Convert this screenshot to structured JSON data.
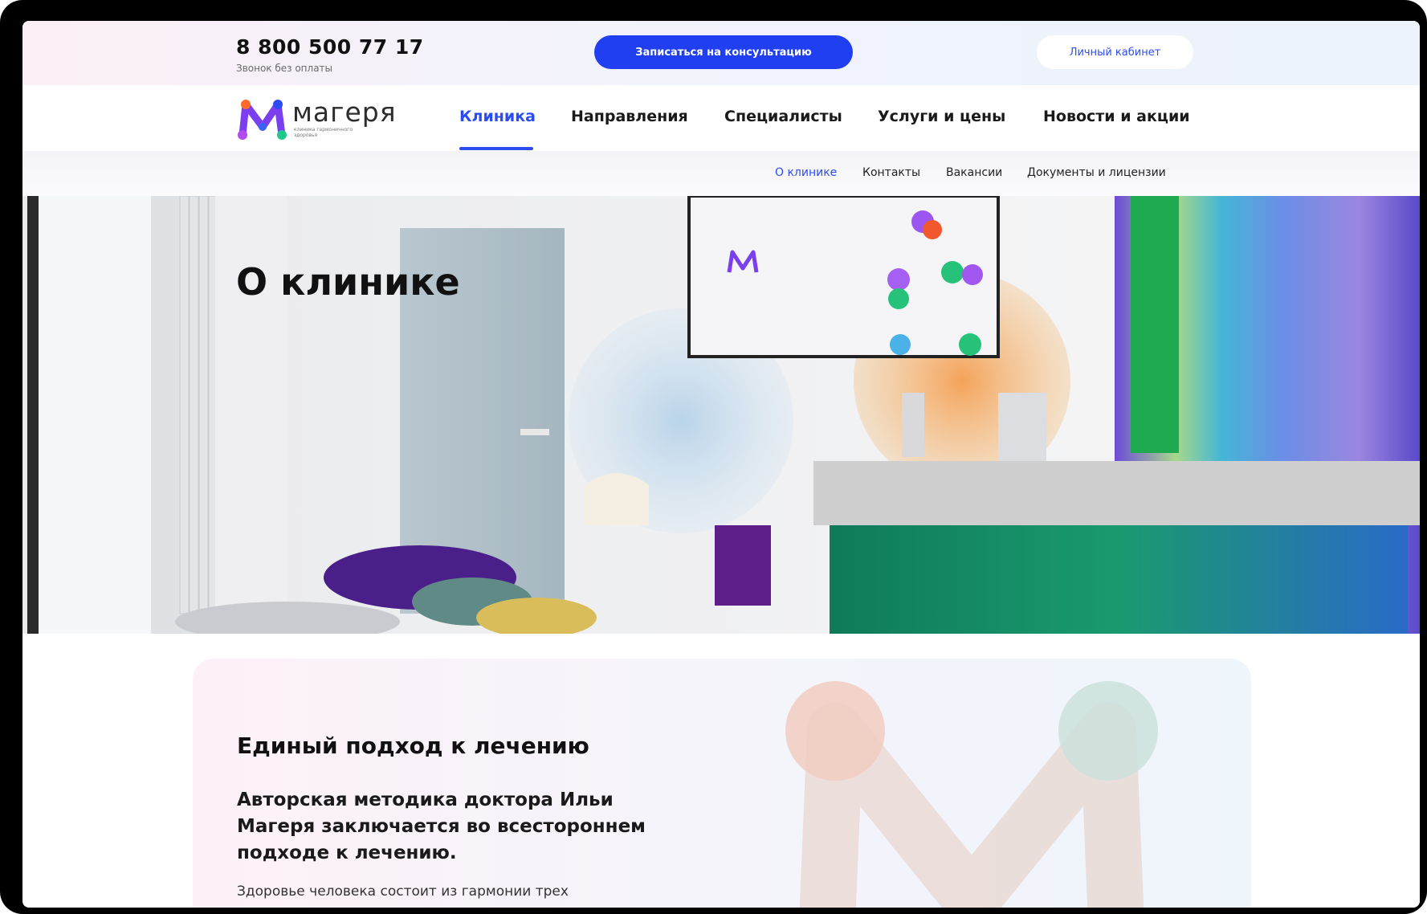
{
  "topbar": {
    "phone": "8 800 500 77 17",
    "phone_caption": "Звонок без оплаты",
    "cta_label": "Записаться на консультацию",
    "cabinet_label": "Личный кабинет"
  },
  "brand": {
    "name": "магеря",
    "tagline": "клиника гармоничного здоровья"
  },
  "nav": {
    "items": [
      {
        "label": "Клиника"
      },
      {
        "label": "Направления"
      },
      {
        "label": "Специалисты"
      },
      {
        "label": "Услуги и цены"
      },
      {
        "label": "Новости и акции"
      }
    ]
  },
  "subnav": {
    "items": [
      {
        "label": "О клинике"
      },
      {
        "label": "Контакты"
      },
      {
        "label": "Вакансии"
      },
      {
        "label": "Документы и лицензии"
      }
    ]
  },
  "hero": {
    "title": "О клинике",
    "screen_brand": "магеря"
  },
  "card": {
    "heading": "Единый подход к лечению",
    "lead": "Авторская методика доктора Ильи Магеря заключается во всестороннем подходе к лечению.",
    "body": "Здоровье человека состоит из гармонии трех"
  },
  "colors": {
    "accent": "#2c4cf2",
    "cta": "#1f3ff0"
  }
}
